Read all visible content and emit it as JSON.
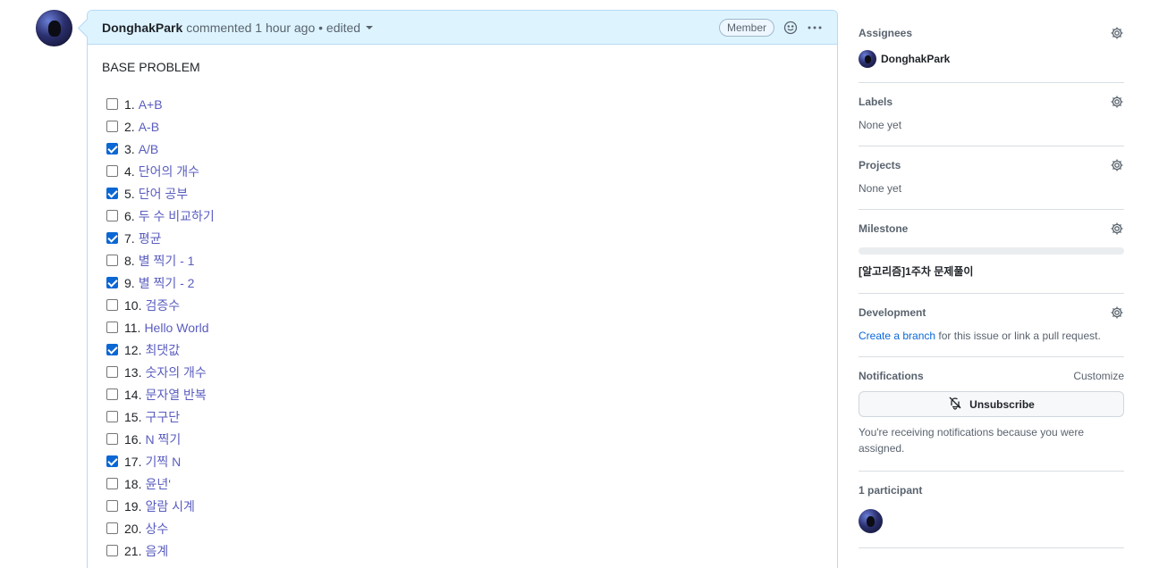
{
  "comment": {
    "author": "DonghakPark",
    "meta": "commented 1 hour ago • edited",
    "badge": "Member",
    "body_title": "BASE PROBLEM",
    "tasks": [
      {
        "num": "1.",
        "label": "A+B",
        "checked": false
      },
      {
        "num": "2.",
        "label": "A-B",
        "checked": false
      },
      {
        "num": "3.",
        "label": "A/B",
        "checked": true
      },
      {
        "num": "4.",
        "label": "단어의 개수",
        "checked": false
      },
      {
        "num": "5.",
        "label": "단어 공부",
        "checked": true
      },
      {
        "num": "6.",
        "label": "두 수 비교하기",
        "checked": false
      },
      {
        "num": "7.",
        "label": "평균",
        "checked": true
      },
      {
        "num": "8.",
        "label": "별 찍기 - 1",
        "checked": false
      },
      {
        "num": "9.",
        "label": "별 찍기 - 2",
        "checked": true
      },
      {
        "num": "10.",
        "label": "검증수",
        "checked": false
      },
      {
        "num": "11.",
        "label": "Hello World",
        "checked": false
      },
      {
        "num": "12.",
        "label": "최댓값",
        "checked": true
      },
      {
        "num": "13.",
        "label": "숫자의 개수",
        "checked": false
      },
      {
        "num": "14.",
        "label": "문자열 반복",
        "checked": false
      },
      {
        "num": "15.",
        "label": "구구단",
        "checked": false
      },
      {
        "num": "16.",
        "label": "N 찍기",
        "checked": false
      },
      {
        "num": "17.",
        "label": "기찍 N",
        "checked": true
      },
      {
        "num": "18.",
        "label": "윤년'",
        "checked": false
      },
      {
        "num": "19.",
        "label": "알람 시계",
        "checked": false
      },
      {
        "num": "20.",
        "label": "상수",
        "checked": false
      },
      {
        "num": "21.",
        "label": "음계",
        "checked": false
      }
    ]
  },
  "sidebar": {
    "assignees": {
      "heading": "Assignees",
      "name": "DonghakPark"
    },
    "labels": {
      "heading": "Labels",
      "value": "None yet"
    },
    "projects": {
      "heading": "Projects",
      "value": "None yet"
    },
    "milestone": {
      "heading": "Milestone",
      "title": "[알고리즘]1주차 문제풀이",
      "progress": 0
    },
    "development": {
      "heading": "Development",
      "link": "Create a branch",
      "rest": " for this issue or link a pull request."
    },
    "notifications": {
      "heading": "Notifications",
      "customize": "Customize",
      "button": "Unsubscribe",
      "text": "You're receiving notifications because you were assigned."
    },
    "participants": {
      "heading": "1 participant"
    }
  }
}
